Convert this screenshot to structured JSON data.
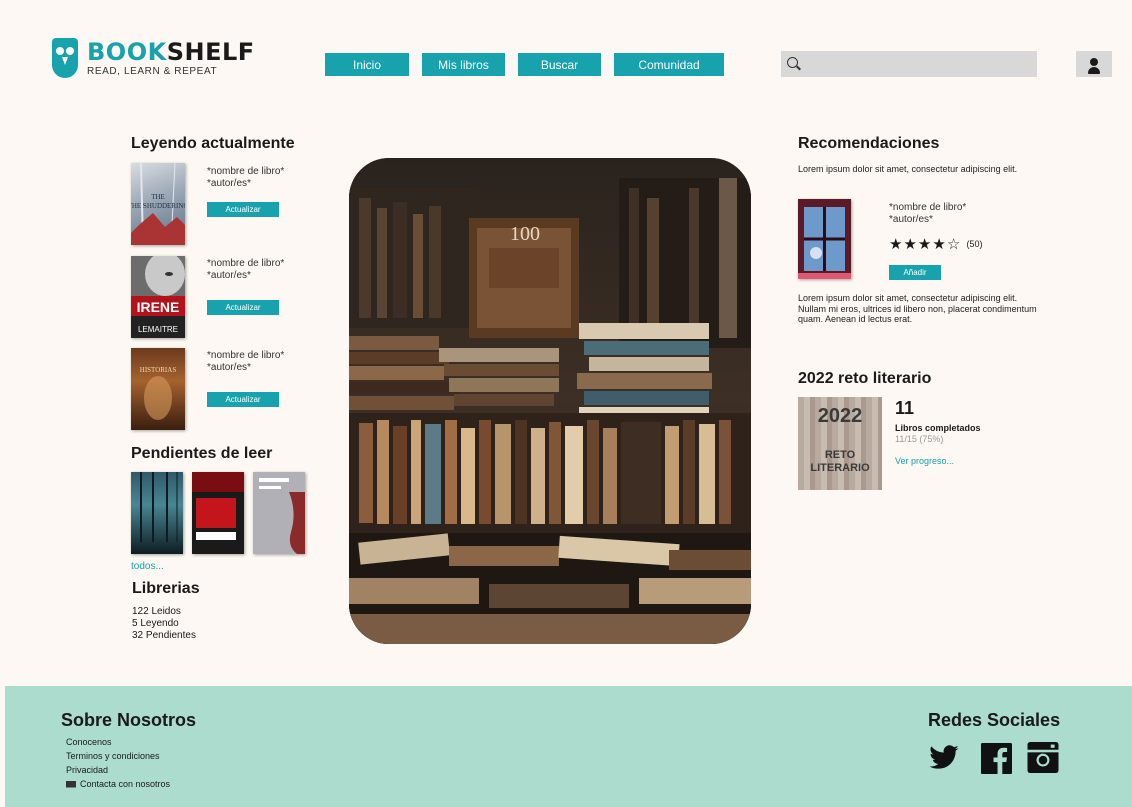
{
  "brand": {
    "name_part1": "BOOK",
    "name_part2": "SHELF",
    "tagline": "READ, LEARN & REPEAT",
    "color": "#17a2ad"
  },
  "nav": [
    {
      "label": "Inicio"
    },
    {
      "label": "Mis libros"
    },
    {
      "label": "Buscar"
    },
    {
      "label": "Comunidad"
    }
  ],
  "search": {
    "placeholder": ""
  },
  "reading": {
    "title": "Leyendo actualmente",
    "books": [
      {
        "cover_title": "THE SHUDDERING",
        "name": "*nombre de libro*",
        "author": "*autor/es*",
        "button": "Actualizar"
      },
      {
        "cover_title": "IRENE",
        "cover_author": "LEMAITRE",
        "name": "*nombre de libro*",
        "author": "*autor/es*",
        "button": "Actualizar"
      },
      {
        "cover_title": "HISTORIAS",
        "name": "*nombre de libro*",
        "author": "*autor/es*",
        "button": "Actualizar"
      }
    ]
  },
  "pending": {
    "title": "Pendientes de leer",
    "more_link": "todos..."
  },
  "libraries": {
    "title": "Librerias",
    "stats": [
      "122 Leidos",
      "5 Leyendo",
      "32 Pendientes"
    ]
  },
  "recommendations": {
    "title": "Recomendaciones",
    "intro": "Lorem ipsum dolor sit amet, consectetur adipiscing elit.",
    "book": {
      "name": "*nombre de libro*",
      "author": "*autor/es*",
      "rating": 4,
      "max_rating": 5,
      "rating_count": "(50)",
      "button": "Añadir"
    },
    "description": "Lorem ipsum dolor sit amet, consectetur adipiscing elit. Nullam mi eros, ultrices id libero non, placerat condimentum quam. Aenean id lectus erat."
  },
  "challenge": {
    "title": "2022 reto literario",
    "cover_year": "2022",
    "cover_text": "RETO LITERARIO",
    "count": "11",
    "label": "Libros completados",
    "progress": "11/15 (75%)",
    "link": "Ver progreso..."
  },
  "footer": {
    "about_title": "Sobre Nosotros",
    "links": [
      "Conocenos",
      "Terminos y condiciones",
      "Privacidad",
      "Contacta con nosotros"
    ],
    "social_title": "Redes Sociales",
    "social_icons": [
      "twitter-icon",
      "facebook-icon",
      "instagram-icon"
    ],
    "bg": "#abdcce"
  }
}
